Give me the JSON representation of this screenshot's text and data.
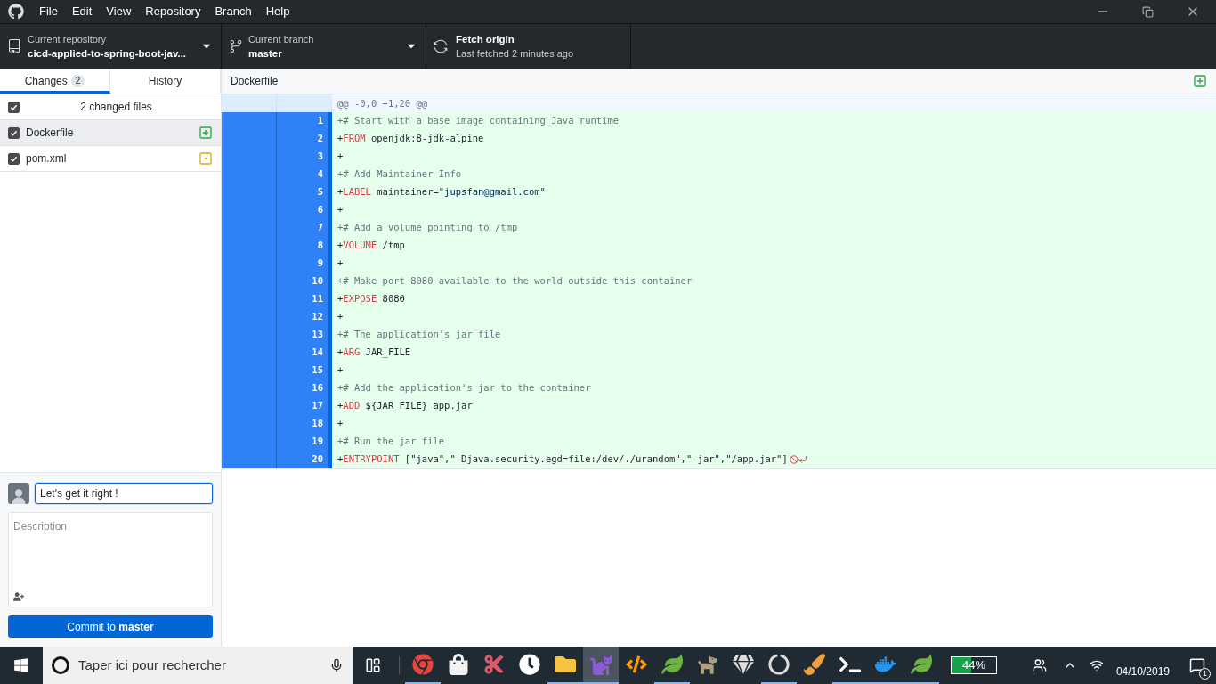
{
  "menu": [
    "File",
    "Edit",
    "View",
    "Repository",
    "Branch",
    "Help"
  ],
  "toolbar": {
    "repository": {
      "label": "Current repository",
      "value": "cicd-applied-to-spring-boot-jav..."
    },
    "branch": {
      "label": "Current branch",
      "value": "master"
    },
    "fetch": {
      "title": "Fetch origin",
      "subtitle": "Last fetched 2 minutes ago"
    }
  },
  "tabs": [
    {
      "label": "Changes",
      "count": "2",
      "selected": true
    },
    {
      "label": "History",
      "selected": false
    }
  ],
  "changes": {
    "summary": "2 changed files",
    "all_checked": true,
    "files": [
      {
        "name": "Dockerfile",
        "checked": true,
        "selected": true,
        "kind": "added"
      },
      {
        "name": "pom.xml",
        "checked": true,
        "selected": false,
        "kind": "modified"
      }
    ]
  },
  "commit": {
    "summary": "Let's get it right !",
    "description_placeholder": "Description",
    "button": "Commit to **master**"
  },
  "diff": {
    "file": "Dockerfile",
    "kind": "added",
    "hunk": "@@ -0,0 +1,20 @@",
    "lines": [
      {
        "number": "1",
        "kind": "comment",
        "text": "+# Start with a base image containing Java runtime"
      },
      {
        "number": "2",
        "kind": "instruction",
        "marker": "+",
        "keyword": "FROM",
        "args": "openjdk:8-jdk-alpine"
      },
      {
        "number": "3",
        "kind": "blank",
        "text": "+"
      },
      {
        "number": "4",
        "kind": "comment",
        "text": "+# Add Maintainer Info"
      },
      {
        "number": "5",
        "kind": "instruction",
        "marker": "+",
        "keyword": "LABEL",
        "args": "maintainer=",
        "string": "\"jupsfan@gmail.com\""
      },
      {
        "number": "6",
        "kind": "blank",
        "text": "+"
      },
      {
        "number": "7",
        "kind": "comment",
        "text": "+# Add a volume pointing to /tmp"
      },
      {
        "number": "8",
        "kind": "instruction",
        "marker": "+",
        "keyword": "VOLUME",
        "args": "/tmp"
      },
      {
        "number": "9",
        "kind": "blank",
        "text": "+"
      },
      {
        "number": "10",
        "kind": "comment",
        "text": "+# Make port 8080 available to the world outside this container"
      },
      {
        "number": "11",
        "kind": "instruction",
        "marker": "+",
        "keyword": "EXPOSE",
        "args": "8080"
      },
      {
        "number": "12",
        "kind": "blank",
        "text": "+"
      },
      {
        "number": "13",
        "kind": "comment",
        "text": "+# The application's jar file"
      },
      {
        "number": "14",
        "kind": "instruction",
        "marker": "+",
        "keyword": "ARG",
        "args": "JAR_FILE"
      },
      {
        "number": "15",
        "kind": "blank",
        "text": "+"
      },
      {
        "number": "16",
        "kind": "comment",
        "text": "+# Add the application's jar to the container"
      },
      {
        "number": "17",
        "kind": "instruction",
        "marker": "+",
        "keyword": "ADD",
        "args": "${JAR_FILE} app.jar"
      },
      {
        "number": "18",
        "kind": "blank",
        "text": "+"
      },
      {
        "number": "19",
        "kind": "comment",
        "text": "+# Run the jar file"
      },
      {
        "number": "20",
        "kind": "instruction",
        "marker": "+",
        "keyword": "ENTRYPOINT",
        "args": "[\"java\",\"-Djava.security.egd=file:/dev/./urandom\",\"-jar\",\"/app.jar\"]",
        "no_newline": true
      }
    ]
  },
  "taskbar": {
    "search_placeholder": "Taper ici pour rechercher",
    "apps": [
      {
        "kind": "browser",
        "running": true,
        "selected": false
      },
      {
        "kind": "store",
        "running": false,
        "selected": false
      },
      {
        "kind": "snip",
        "running": false,
        "selected": false
      },
      {
        "kind": "alarm",
        "running": false,
        "selected": false
      },
      {
        "kind": "folder",
        "running": true,
        "selected": false
      },
      {
        "kind": "cat",
        "running": true,
        "selected": true
      },
      {
        "kind": "editor",
        "running": false,
        "selected": false
      },
      {
        "kind": "leaf",
        "running": true,
        "selected": false
      },
      {
        "kind": "gimp",
        "running": false,
        "selected": false
      },
      {
        "kind": "vector",
        "running": false,
        "selected": false
      },
      {
        "kind": "recorder",
        "running": true,
        "selected": false
      },
      {
        "kind": "paint",
        "running": false,
        "selected": false
      },
      {
        "kind": "terminal",
        "running": true,
        "selected": false
      },
      {
        "kind": "docker",
        "running": true,
        "selected": false
      },
      {
        "kind": "leaf",
        "running": true,
        "selected": false
      }
    ],
    "battery": {
      "reading": "44%",
      "level": 0.44
    },
    "date": "04/10/2019",
    "notifications": "1"
  }
}
